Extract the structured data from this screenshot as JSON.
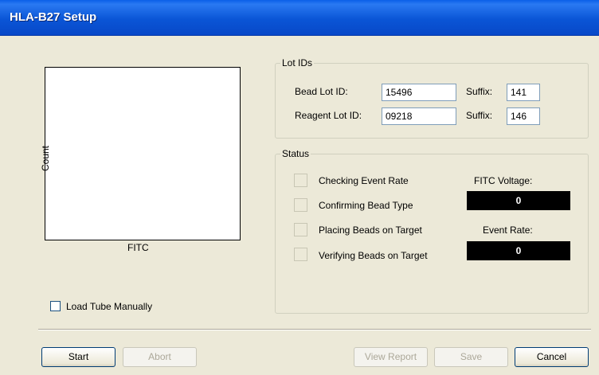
{
  "window": {
    "title": "HLA-B27 Setup"
  },
  "plot": {
    "x_label": "FITC",
    "y_label": "Count"
  },
  "lot_ids": {
    "legend": "Lot IDs",
    "bead_label": "Bead Lot ID:",
    "bead_value": "15496",
    "bead_suffix_label": "Suffix:",
    "bead_suffix_value": "141",
    "reagent_label": "Reagent Lot ID:",
    "reagent_value": "09218",
    "reagent_suffix_label": "Suffix:",
    "reagent_suffix_value": "146"
  },
  "status": {
    "legend": "Status",
    "items": [
      "Checking Event Rate",
      "Confirming Bead Type",
      "Placing Beads on Target",
      "Verifying Beads on Target"
    ],
    "fitc_voltage_label": "FITC Voltage:",
    "fitc_voltage_value": "0",
    "event_rate_label": "Event Rate:",
    "event_rate_value": "0"
  },
  "load_tube_manually": {
    "label": "Load Tube Manually",
    "checked": false
  },
  "buttons": {
    "start": "Start",
    "abort": "Abort",
    "view_report": "View Report",
    "save": "Save",
    "cancel": "Cancel"
  }
}
